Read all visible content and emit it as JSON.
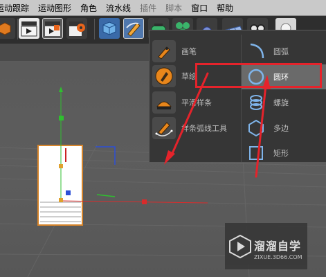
{
  "menubar": {
    "items": [
      "运动跟踪",
      "运动图形",
      "角色",
      "流水线",
      "插件",
      "脚本",
      "窗口",
      "帮助"
    ],
    "dimmed": [
      false,
      false,
      false,
      false,
      true,
      true,
      false,
      false
    ]
  },
  "toolbar": {
    "icons": [
      "object-icon",
      "render-view-icon",
      "render-queue-icon",
      "render-settings-icon",
      "cube-icon",
      "pen-icon",
      "subdivision-icon",
      "cloner-icon",
      "deformer-icon",
      "floor-icon",
      "camera-icon",
      "light-icon"
    ]
  },
  "popup": {
    "left_items": [
      {
        "label": "画笔",
        "icon": "pen-brush-icon"
      },
      {
        "label": "草绘",
        "icon": "sketch-icon"
      },
      {
        "label": "平滑样条",
        "icon": "smooth-spline-icon"
      },
      {
        "label": "样条弧线工具",
        "icon": "spline-arc-tool-icon"
      }
    ],
    "right_items": [
      {
        "label": "圆弧",
        "icon": "arc-icon",
        "highlighted": false
      },
      {
        "label": "圆环",
        "icon": "circle-icon",
        "highlighted": true
      },
      {
        "label": "螺旋",
        "icon": "helix-icon",
        "highlighted": false
      },
      {
        "label": "多边",
        "icon": "polygon-icon",
        "highlighted": false
      },
      {
        "label": "矩形",
        "icon": "rectangle-icon",
        "highlighted": false
      }
    ]
  },
  "colors": {
    "accent_red": "#e5232b",
    "highlight": "#6a6a6a",
    "axis_x": "#d92b2b",
    "axis_y": "#2fbf2f",
    "axis_z": "#2c4fd6"
  },
  "watermark": {
    "title": "溜溜自学",
    "subtitle": "ZIXUE.3D66.COM"
  }
}
